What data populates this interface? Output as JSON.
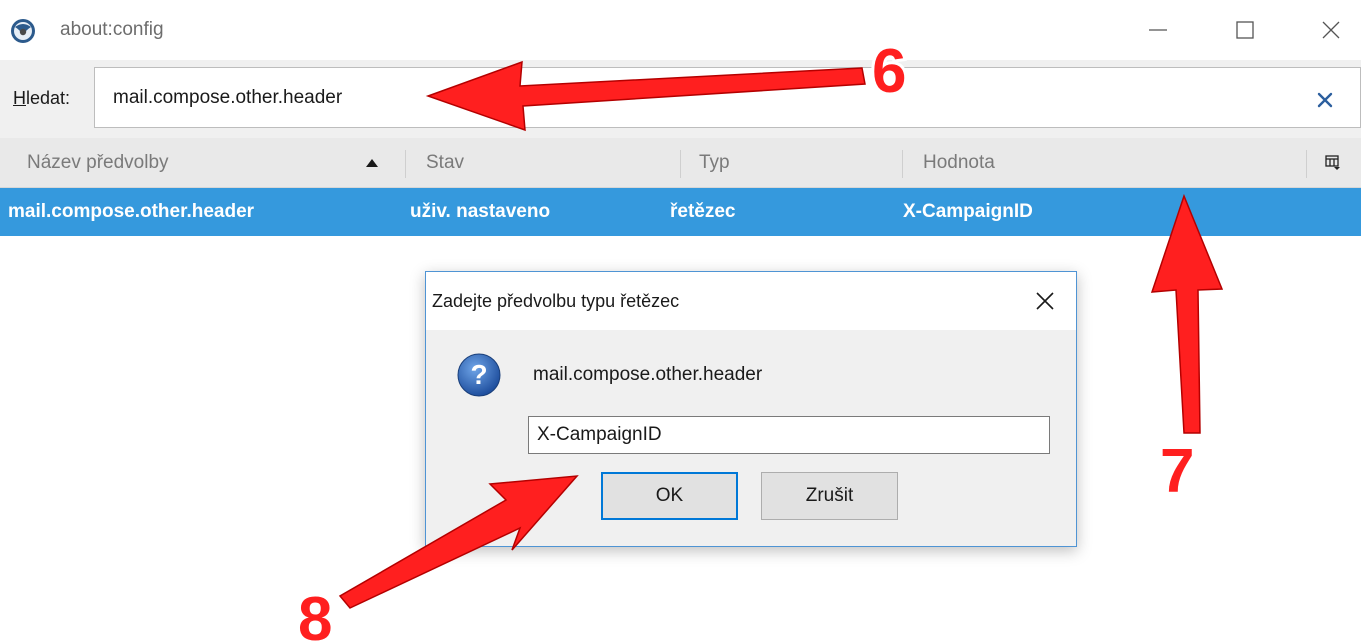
{
  "window": {
    "title": "about:config",
    "icon": "thunderbird-logo-icon"
  },
  "search": {
    "label_accesskey": "H",
    "label_rest": "ledat:",
    "value": "mail.compose.other.header"
  },
  "columns": {
    "name": "Název předvolby",
    "status": "Stav",
    "type": "Typ",
    "value": "Hodnota"
  },
  "rows": [
    {
      "name": "mail.compose.other.header",
      "status": "uživ. nastaveno",
      "type": "řetězec",
      "value": "X-CampaignID"
    }
  ],
  "dialog": {
    "title": "Zadejte předvolbu typu řetězec",
    "message": "mail.compose.other.header",
    "input_value": "X-CampaignID",
    "ok_label": "OK",
    "cancel_label": "Zrušit"
  },
  "annotations": [
    "6",
    "7",
    "8"
  ],
  "colors": {
    "selection": "#3599dd",
    "annotation": "#ff1f1f",
    "accent": "#0078d7"
  }
}
